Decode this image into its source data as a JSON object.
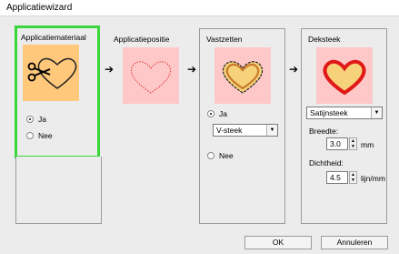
{
  "window": {
    "title": "Applicatiewizard"
  },
  "steps": [
    {
      "title": "Applicatiemateriaal",
      "icon": "heart-scissors-icon"
    },
    {
      "title": "Applicatiepositie",
      "icon": "heart-dotted-outline-icon"
    },
    {
      "title": "Vastzetten",
      "icon": "heart-tack-stitch-icon"
    },
    {
      "title": "Deksteek",
      "icon": "heart-satin-stitch-icon"
    }
  ],
  "material": {
    "option_yes": "Ja",
    "option_no": "Nee",
    "selected": "Ja"
  },
  "tack": {
    "option_yes": "Ja",
    "option_no": "Nee",
    "selected": "Ja",
    "stitch_type": "V-steek"
  },
  "cover": {
    "stitch_type": "Satijnsteek",
    "width_label": "Breedte:",
    "width_value": "3.0",
    "width_unit": "mm",
    "density_label": "Dichtheid:",
    "density_value": "4.5",
    "density_unit": "lijn/mm"
  },
  "buttons": {
    "ok": "OK",
    "cancel": "Annuleren"
  },
  "colors": {
    "highlight": "#3bd63b",
    "active_step_bg": "#ffc87a",
    "preview_bg": "#ffc8c8"
  }
}
